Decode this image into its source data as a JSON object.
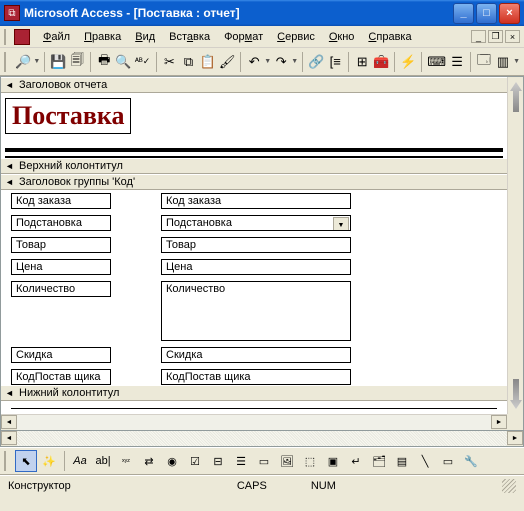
{
  "window": {
    "title": "Microsoft Access - [Поставка : отчет]"
  },
  "menu": {
    "file": "Файл",
    "edit": "Правка",
    "view": "Вид",
    "insert": "Вставка",
    "format": "Формат",
    "tools": "Сервис",
    "window": "Окно",
    "help": "Справка"
  },
  "sections": {
    "report_header": "Заголовок отчета",
    "page_header": "Верхний колонтитул",
    "group_header": "Заголовок группы 'Код'",
    "page_footer": "Нижний колонтитул"
  },
  "report": {
    "title": "Поставка"
  },
  "fields": {
    "order_code": {
      "label": "Код заказа",
      "value": "Код заказа"
    },
    "substitution": {
      "label": "Подстановка",
      "value": "Подстановка"
    },
    "product": {
      "label": "Товар",
      "value": "Товар"
    },
    "price": {
      "label": "Цена",
      "value": "Цена"
    },
    "quantity": {
      "label": "Количество",
      "value": "Количество"
    },
    "discount": {
      "label": "Скидка",
      "value": "Скидка"
    },
    "supplier_code": {
      "label": "КодПостав щика",
      "value": "КодПостав щика"
    }
  },
  "status": {
    "mode": "Конструктор",
    "caps": "CAPS",
    "num": "NUM"
  }
}
